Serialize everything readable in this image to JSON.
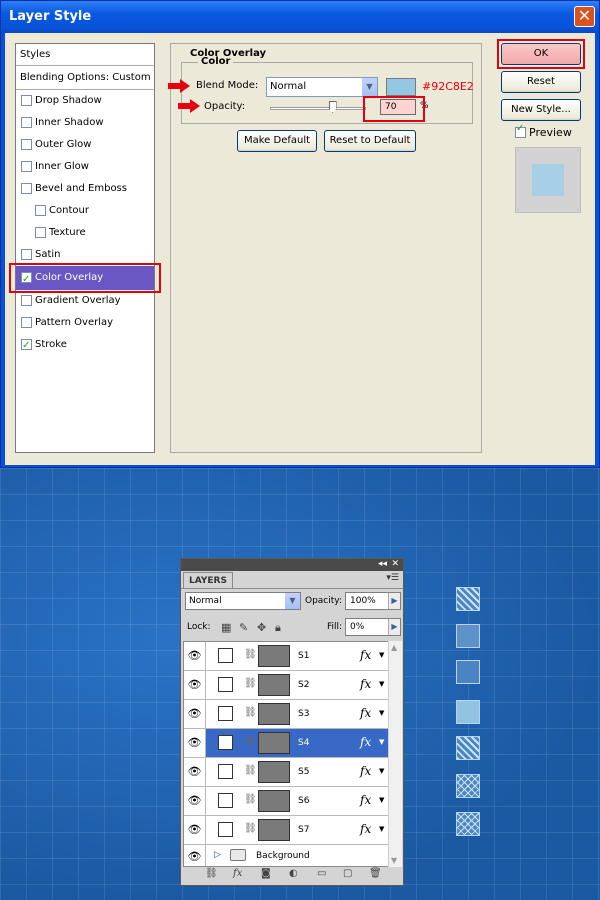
{
  "dialog": {
    "title": "Layer Style",
    "styles_header": "Styles",
    "blending_options": "Blending Options: Custom",
    "style_items": [
      {
        "label": "Drop Shadow",
        "checked": false
      },
      {
        "label": "Inner Shadow",
        "checked": false
      },
      {
        "label": "Outer Glow",
        "checked": false
      },
      {
        "label": "Inner Glow",
        "checked": false
      },
      {
        "label": "Bevel and Emboss",
        "checked": false
      },
      {
        "label": "Contour",
        "checked": false
      },
      {
        "label": "Texture",
        "checked": false
      },
      {
        "label": "Satin",
        "checked": false
      },
      {
        "label": "Color Overlay",
        "checked": true,
        "selected": true
      },
      {
        "label": "Gradient Overlay",
        "checked": false
      },
      {
        "label": "Pattern Overlay",
        "checked": false
      },
      {
        "label": "Stroke",
        "checked": true
      }
    ],
    "panel_title": "Color Overlay",
    "color_group_title": "Color",
    "blend_mode_label": "Blend Mode:",
    "blend_mode_value": "Normal",
    "color_hex": "#92C8E2",
    "opacity_label": "Opacity:",
    "opacity_value": "70",
    "opacity_unit": "%",
    "make_default": "Make Default",
    "reset_to_default": "Reset to Default",
    "ok": "OK",
    "reset": "Reset",
    "new_style": "New Style...",
    "preview": "Preview",
    "preview_checked": true,
    "highlight_color": "#e4000f"
  },
  "layers_panel": {
    "tab": "LAYERS",
    "blend_mode": "Normal",
    "opacity_label": "Opacity:",
    "opacity_value": "100%",
    "lock_label": "Lock:",
    "fill_label": "Fill:",
    "fill_value": "0%",
    "fx_label": "fx",
    "layers": [
      {
        "name": "S1",
        "selected": false
      },
      {
        "name": "S2",
        "selected": false
      },
      {
        "name": "S3",
        "selected": false
      },
      {
        "name": "S4",
        "selected": true
      },
      {
        "name": "S5",
        "selected": false
      },
      {
        "name": "S6",
        "selected": false
      },
      {
        "name": "S7",
        "selected": false
      }
    ],
    "background_layer": "Background"
  }
}
